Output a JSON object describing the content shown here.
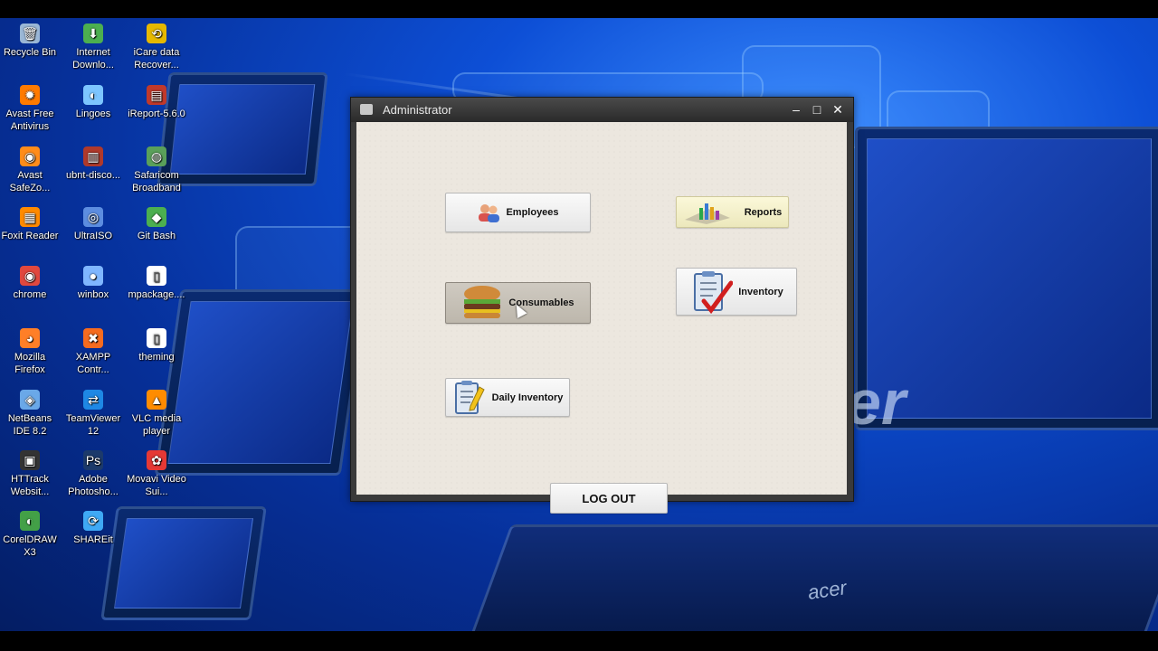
{
  "desktop": {
    "icons": [
      {
        "label": "Recycle Bin",
        "icon": "recycle-bin-icon",
        "color": "#9ab7d6",
        "glyph": "🗑"
      },
      {
        "label": "Internet Downlo...",
        "icon": "internet-download-manager-icon",
        "color": "#4caf50",
        "glyph": "⬇"
      },
      {
        "label": "iCare data Recover...",
        "icon": "icare-data-recovery-icon",
        "color": "#e6b800",
        "glyph": "⟲"
      },
      {
        "label": "Avast Free Antivirus",
        "icon": "avast-icon",
        "color": "#ff7a00",
        "glyph": "✹"
      },
      {
        "label": "Lingoes",
        "icon": "lingoes-icon",
        "color": "#7cc5ff",
        "glyph": "◐"
      },
      {
        "label": "iReport-5.6.0",
        "icon": "ireport-icon",
        "color": "#c0392b",
        "glyph": "▤"
      },
      {
        "label": "Avast SafeZo...",
        "icon": "avast-safezone-icon",
        "color": "#ff8c1a",
        "glyph": "◉"
      },
      {
        "label": "ubnt-disco...",
        "icon": "ubnt-discovery-icon",
        "color": "#b0392b",
        "glyph": "▥"
      },
      {
        "label": "Safaricom Broadband",
        "icon": "safaricom-icon",
        "color": "#5aa05a",
        "glyph": "◍"
      },
      {
        "label": "Foxit Reader",
        "icon": "foxit-reader-icon",
        "color": "#ff8a00",
        "glyph": "▦"
      },
      {
        "label": "UltraISO",
        "icon": "ultraiso-icon",
        "color": "#5c8de0",
        "glyph": "◎"
      },
      {
        "label": "Git Bash",
        "icon": "git-bash-icon",
        "color": "#4caf50",
        "glyph": "◆"
      },
      {
        "label": "chrome",
        "icon": "chrome-icon",
        "color": "#e0483e",
        "glyph": "◉"
      },
      {
        "label": "winbox",
        "icon": "winbox-icon",
        "color": "#7fb6ff",
        "glyph": "●"
      },
      {
        "label": "mpackage....",
        "icon": "file-icon",
        "color": "#ffffff",
        "glyph": "▯"
      },
      {
        "label": "Mozilla Firefox",
        "icon": "firefox-icon",
        "color": "#ff7f27",
        "glyph": "◕"
      },
      {
        "label": "XAMPP Contr...",
        "icon": "xampp-icon",
        "color": "#f56b1f",
        "glyph": "✖"
      },
      {
        "label": "theming",
        "icon": "file-icon",
        "color": "#ffffff",
        "glyph": "▯"
      },
      {
        "label": "NetBeans IDE 8.2",
        "icon": "netbeans-icon",
        "color": "#6aa8e8",
        "glyph": "◈"
      },
      {
        "label": "TeamViewer 12",
        "icon": "teamviewer-icon",
        "color": "#1e88e5",
        "glyph": "⇄"
      },
      {
        "label": "VLC media player",
        "icon": "vlc-icon",
        "color": "#ff8c00",
        "glyph": "▲"
      },
      {
        "label": "HTTrack Websit...",
        "icon": "httrack-icon",
        "color": "#333333",
        "glyph": "▣"
      },
      {
        "label": "Adobe Photosho...",
        "icon": "photoshop-icon",
        "color": "#1c3a6b",
        "glyph": "Ps"
      },
      {
        "label": "Movavi Video Sui...",
        "icon": "movavi-icon",
        "color": "#e53935",
        "glyph": "✿"
      },
      {
        "label": "CorelDRAW X3",
        "icon": "coreldraw-icon",
        "color": "#43a047",
        "glyph": "◐"
      },
      {
        "label": "SHAREit",
        "icon": "shareit-icon",
        "color": "#3fa9f5",
        "glyph": "⟳"
      }
    ],
    "brand_text": "acer",
    "brand_script": "er"
  },
  "window": {
    "title": "Administrator",
    "minimize": "–",
    "maximize": "□",
    "close": "✕",
    "buttons": {
      "employees": "Employees",
      "reports": "Reports",
      "consumables": "Consumables",
      "inventory": "Inventory",
      "daily_inventory": "Daily Inventory",
      "logout": "LOG OUT"
    }
  },
  "colors": {
    "titlebar": "#333333",
    "content_bg": "#ece7df"
  }
}
